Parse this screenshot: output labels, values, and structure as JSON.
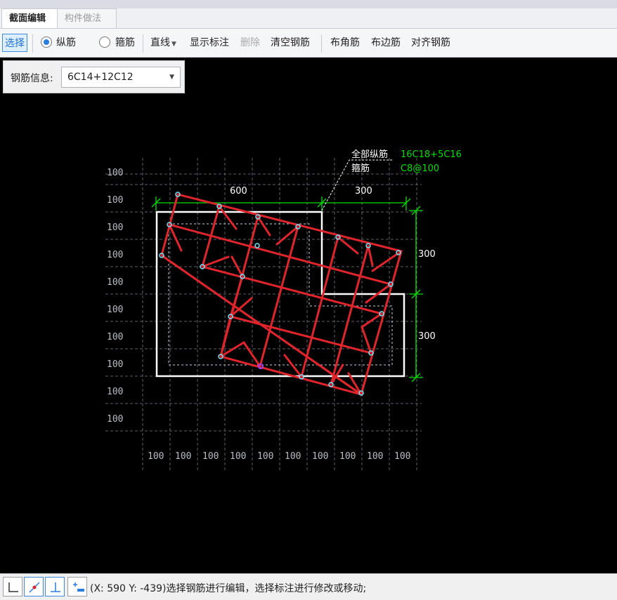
{
  "tabs": [
    {
      "label": "截面编辑",
      "active": true
    },
    {
      "label": "构件做法",
      "active": false
    }
  ],
  "toolbar": {
    "select": "选择",
    "longitudinal": "纵筋",
    "stirrup": "箍筋",
    "line": "直线",
    "show_dimension": "显示标注",
    "delete": "删除",
    "clear_rebar": "清空钢筋",
    "corner_rebar": "布角筋",
    "edge_rebar": "布边筋",
    "align_rebar": "对齐钢筋"
  },
  "rebar_info": {
    "label": "钢筋信息:",
    "value": "6C14+12C12"
  },
  "drawing": {
    "grid_label": "100",
    "dim_top_left": "600",
    "dim_top_right": "300",
    "dim_right_top": "300",
    "dim_right_bottom": "300",
    "note_all_long_label": "全部纵筋",
    "note_all_long_value": "16C18+5C16",
    "note_stirrup_label": "箍筋",
    "note_stirrup_value": "C8@100"
  },
  "colors": {
    "rebar": "#e0242c",
    "outline": "#ffffff",
    "dimension": "#00e000",
    "grid": "#7a7f88",
    "note_value": "#00e000"
  },
  "status": {
    "text": "(X: 590 Y: -439)选择钢筋进行编辑，选择标注进行修改或移动;"
  },
  "icons": [
    "orthogonal-icon",
    "snap-point-icon",
    "perpendicular-icon",
    "insert-icon"
  ]
}
